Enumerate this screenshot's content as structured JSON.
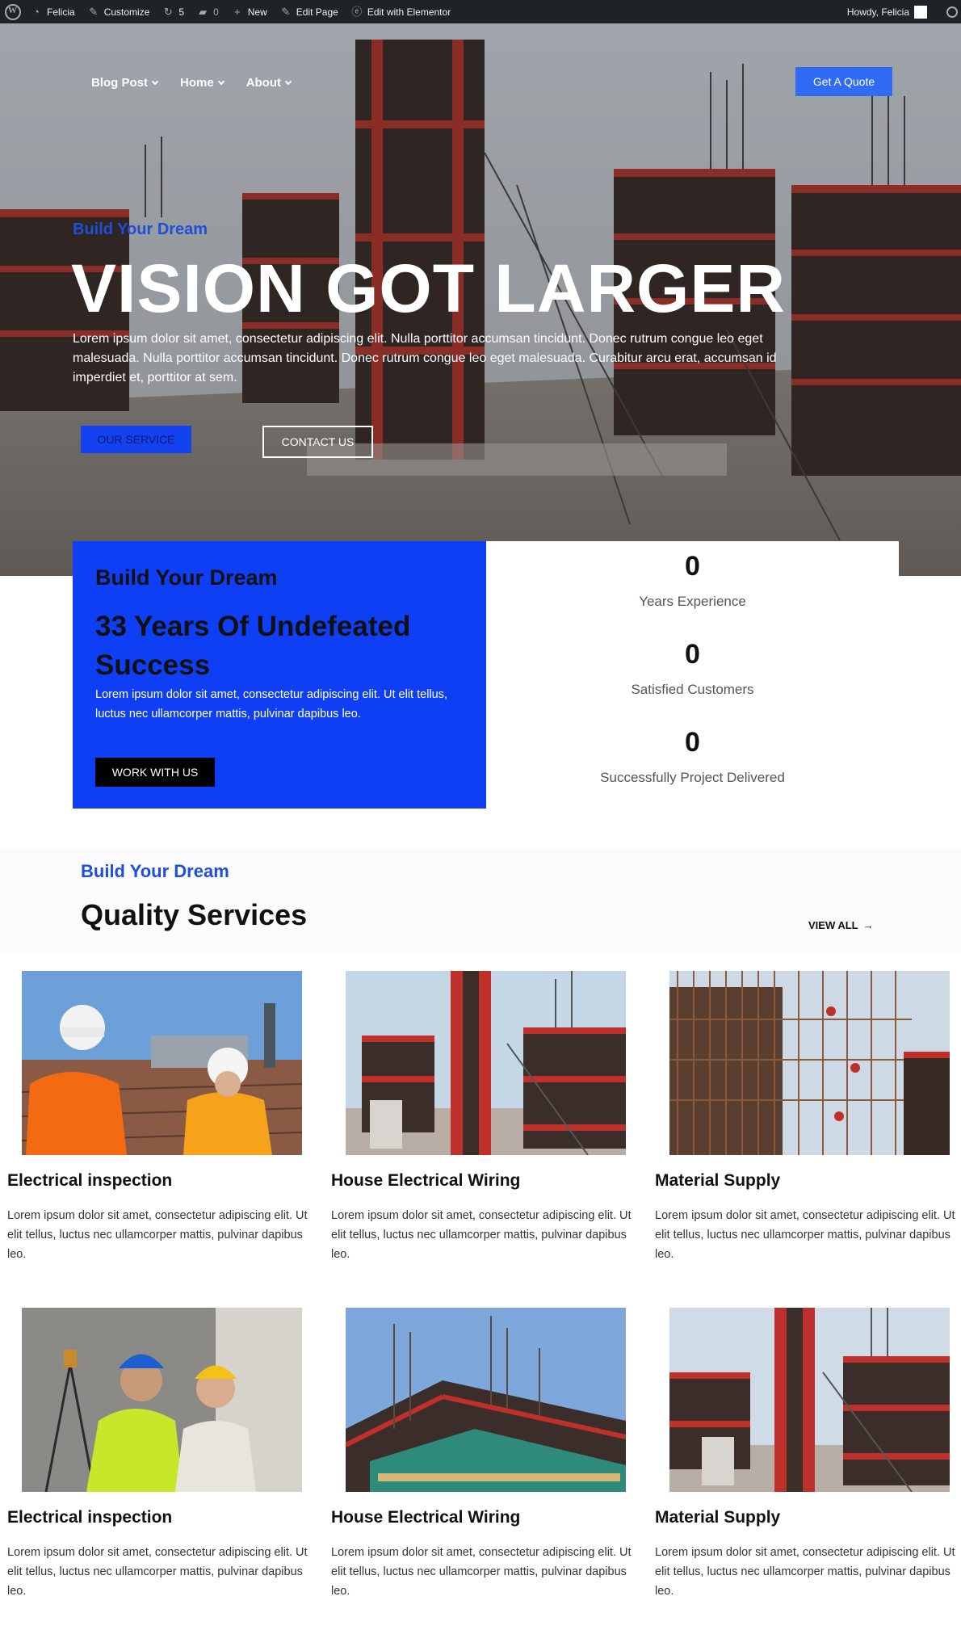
{
  "admin_bar": {
    "site_name": "Felicia",
    "customize": "Customize",
    "updates_count": "5",
    "comments_count": "0",
    "new_label": "New",
    "edit_page": "Edit Page",
    "edit_elementor": "Edit with Elementor",
    "greeting": "Howdy, Felicia"
  },
  "nav": {
    "items": [
      {
        "label": "Blog Post"
      },
      {
        "label": "Home"
      },
      {
        "label": "About"
      }
    ],
    "cta": "Get A Quote"
  },
  "hero": {
    "eyebrow": "Build Your Dream",
    "title": "VISION GOT LARGER",
    "text": "Lorem ipsum dolor sit amet, consectetur adipiscing elit. Nulla porttitor accumsan tincidunt. Donec rutrum congue leo eget malesuada. Nulla porttitor accumsan tincidunt. Donec rutrum congue leo eget malesuada. Curabitur arcu erat, accumsan id imperdiet et, porttitor at sem.",
    "btn_service": "OUR SERVICE",
    "btn_contact": "CONTACT US"
  },
  "about": {
    "eyebrow": "Build Your Dream",
    "title": "33 Years Of Undefeated Success",
    "text": "Lorem ipsum dolor sit amet, consectetur adipiscing elit. Ut elit tellus, luctus nec ullamcorper mattis, pulvinar dapibus leo.",
    "button": "WORK WITH US"
  },
  "stats": [
    {
      "value": "0",
      "label": "Years Experience"
    },
    {
      "value": "0",
      "label": "Satisfied Customers"
    },
    {
      "value": "0",
      "label": "Successfully Project Delivered"
    }
  ],
  "services": {
    "eyebrow": "Build Your Dream",
    "title": "Quality Services",
    "view_all": "VIEW ALL",
    "cards": [
      {
        "title": "Electrical inspection",
        "text": "Lorem ipsum dolor sit amet, consectetur adipiscing elit. Ut elit tellus, luctus nec ullamcorper mattis, pulvinar dapibus leo."
      },
      {
        "title": "House Electrical Wiring",
        "text": "Lorem ipsum dolor sit amet, consectetur adipiscing elit. Ut elit tellus, luctus nec ullamcorper mattis, pulvinar dapibus leo."
      },
      {
        "title": "Material Supply",
        "text": "Lorem ipsum dolor sit amet, consectetur adipiscing elit. Ut elit tellus, luctus nec ullamcorper mattis, pulvinar dapibus leo."
      },
      {
        "title": "Electrical inspection",
        "text": "Lorem ipsum dolor sit amet, consectetur adipiscing elit. Ut elit tellus, luctus nec ullamcorper mattis, pulvinar dapibus leo."
      },
      {
        "title": "House Electrical Wiring",
        "text": "Lorem ipsum dolor sit amet, consectetur adipiscing elit. Ut elit tellus, luctus nec ullamcorper mattis, pulvinar dapibus leo."
      },
      {
        "title": "Material Supply",
        "text": "Lorem ipsum dolor sit amet, consectetur adipiscing elit. Ut elit tellus, luctus nec ullamcorper mattis, pulvinar dapibus leo."
      }
    ]
  },
  "colors": {
    "accent": "#2f6bf5",
    "panel_blue": "#0f3ff5",
    "eyebrow_blue": "#1f4fd8",
    "admin_bar": "#1d2327",
    "formwork_red": "#c0302a"
  }
}
